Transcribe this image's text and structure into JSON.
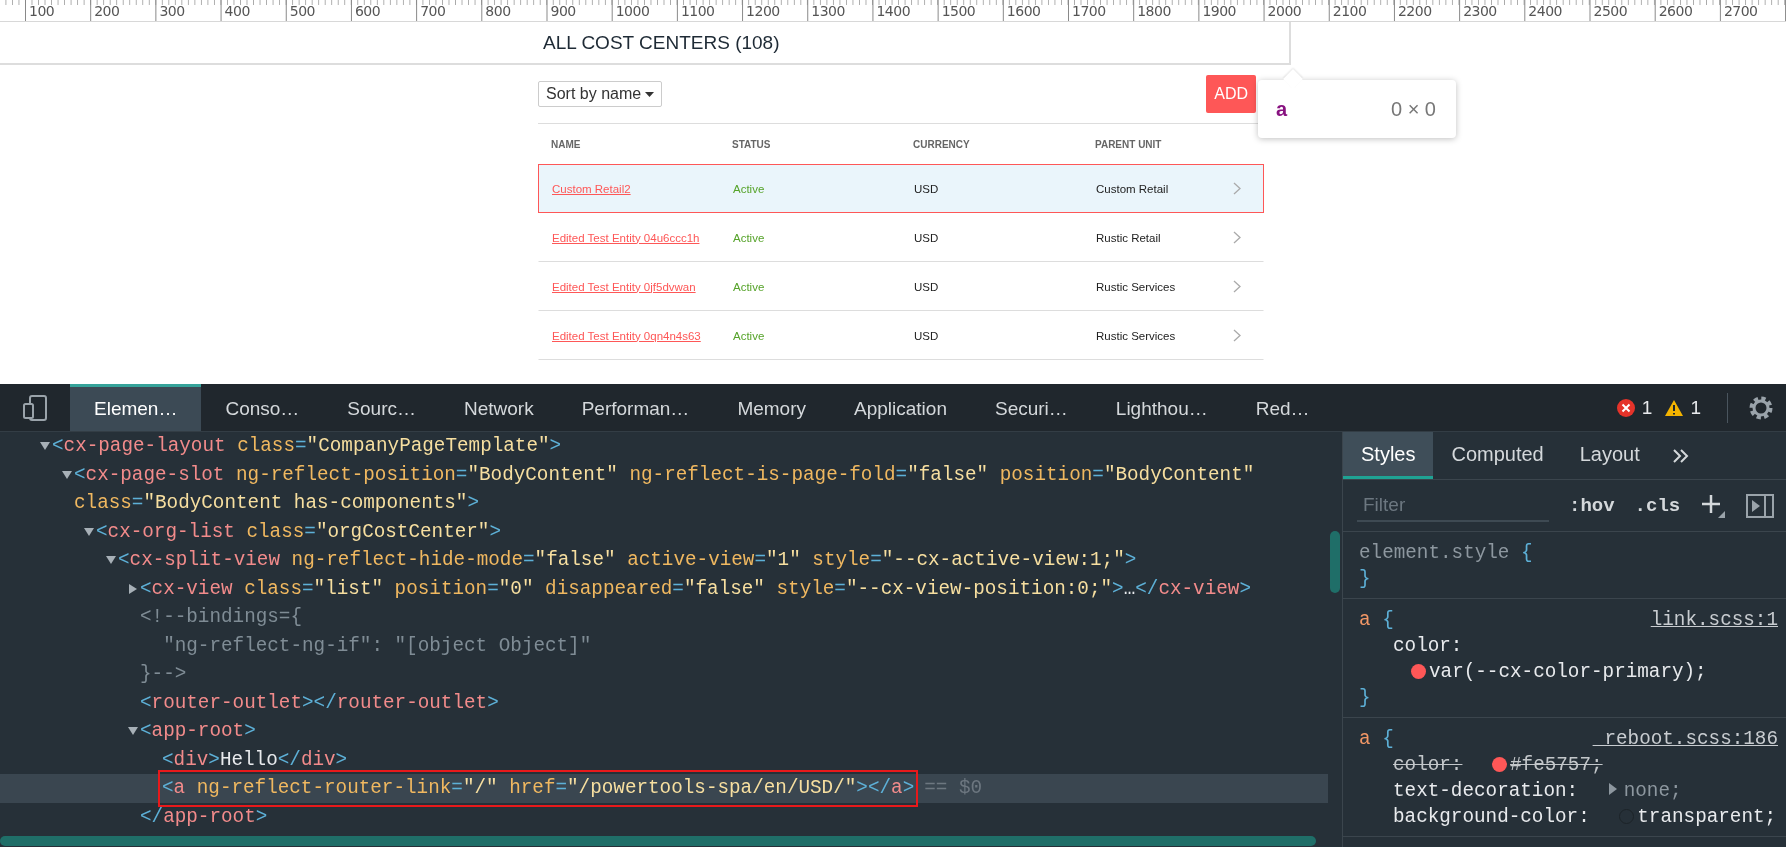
{
  "ruler": {
    "labels": [
      "100",
      "200",
      "300",
      "400",
      "500",
      "600",
      "700",
      "800",
      "900",
      "1000",
      "1100",
      "1200",
      "1300",
      "1400",
      "1500",
      "1600",
      "1700",
      "1800",
      "1900",
      "2000",
      "2100",
      "2200",
      "2300",
      "2400",
      "2500",
      "2600",
      "2700"
    ]
  },
  "page": {
    "title": "ALL COST CENTERS (108)",
    "sort": {
      "label": "Sort by name"
    },
    "add_button": "ADD",
    "table": {
      "columns": [
        "NAME",
        "STATUS",
        "CURRENCY",
        "PARENT UNIT"
      ],
      "rows": [
        {
          "name": "Custom Retail2",
          "status": "Active",
          "currency": "USD",
          "parent_unit": "Custom Retail",
          "selected": true
        },
        {
          "name": "Edited Test Entity 04u6ccc1h",
          "status": "Active",
          "currency": "USD",
          "parent_unit": "Rustic Retail",
          "selected": false
        },
        {
          "name": "Edited Test Entity 0jf5dvwan",
          "status": "Active",
          "currency": "USD",
          "parent_unit": "Rustic Services",
          "selected": false
        },
        {
          "name": "Edited Test Entity 0qn4n4s63",
          "status": "Active",
          "currency": "USD",
          "parent_unit": "Rustic Services",
          "selected": false
        }
      ]
    }
  },
  "inspect_tooltip": {
    "tag": "a",
    "size": "0 × 0"
  },
  "devtools": {
    "tabs": [
      {
        "label": "Elemen…",
        "selected": true
      },
      {
        "label": "Conso…",
        "selected": false
      },
      {
        "label": "Sourc…",
        "selected": false
      },
      {
        "label": "Network",
        "selected": false
      },
      {
        "label": "Performan…",
        "selected": false
      },
      {
        "label": "Memory",
        "selected": false
      },
      {
        "label": "Application",
        "selected": false
      },
      {
        "label": "Securi…",
        "selected": false
      },
      {
        "label": "Lighthou…",
        "selected": false
      },
      {
        "label": "Red…",
        "selected": false
      }
    ],
    "errors": "1",
    "warnings": "1",
    "dom_tree": [
      {
        "kind": "parent",
        "text": "<cx-page-layout class=\"CompanyPageTemplate\">",
        "expanded": true,
        "selected": false,
        "children": [
          {
            "kind": "parent",
            "text": "<cx-page-slot ng-reflect-position=\"BodyContent\" ng-reflect-is-page-fold=\"false\" position=\"BodyContent\" class=\"BodyContent has-components\">",
            "expanded": true,
            "selected": false,
            "children": [
              {
                "kind": "parent",
                "text": "<cx-org-list class=\"orgCostCenter\">",
                "expanded": true,
                "selected": false,
                "children": [
                  {
                    "kind": "parent",
                    "text": "<cx-split-view ng-reflect-hide-mode=\"false\" active-view=\"1\" style=\"--cx-active-view:1;\">",
                    "expanded": true,
                    "selected": false,
                    "children": [
                      {
                        "kind": "parent",
                        "text": "<cx-view class=\"list\" position=\"0\" disappeared=\"false\" style=\"--cx-view-position:0;\">…</cx-view>",
                        "expanded": false,
                        "selected": false
                      },
                      {
                        "kind": "comment",
                        "text": "<!--bindings={\n  \"ng-reflect-ng-if\": \"[object Object]\"\n}-->",
                        "selected": false
                      },
                      {
                        "kind": "leaf",
                        "text": "<router-outlet></router-outlet>",
                        "selected": false
                      },
                      {
                        "kind": "parent",
                        "text": "<app-root>",
                        "expanded": true,
                        "selected": false,
                        "close": "</app-root>",
                        "children": [
                          {
                            "kind": "leaf",
                            "text": "<div>Hello</div>",
                            "selected": false
                          },
                          {
                            "kind": "leaf",
                            "text": "<a ng-reflect-router-link=\"/\" href=\"/powertools-spa/en/USD/\"></a>",
                            "selected": true,
                            "hint": "== $0"
                          }
                        ]
                      }
                    ]
                  }
                ]
              }
            ]
          }
        ]
      }
    ],
    "styles_panel": {
      "tabs": [
        {
          "label": "Styles",
          "selected": true
        },
        {
          "label": "Computed",
          "selected": false
        },
        {
          "label": "Layout",
          "selected": false
        }
      ],
      "filter": {
        "placeholder": "Filter"
      },
      "hov": ":hov",
      "cls": ".cls",
      "rules": [
        {
          "kind": "inline",
          "selector": "element.style",
          "open_brace": "{",
          "close_brace": "}"
        },
        {
          "kind": "rule",
          "selector": "a",
          "open_brace": "{",
          "close_brace": "}",
          "source": "link.scss:1",
          "declarations": [
            {
              "kind": "color",
              "property": "color:",
              "value": "var(--cx-color-primary);",
              "color": "#fe5757",
              "struck": false,
              "dimmed": false
            }
          ]
        },
        {
          "kind": "rule",
          "selector": "a",
          "open_brace": "{",
          "source": "_reboot.scss:186",
          "declarations": [
            {
              "kind": "color",
              "property": "color:",
              "value": "#fe5757;",
              "color": "#fe5757",
              "struck": true,
              "dimmed": false
            },
            {
              "kind": "expandable",
              "property": "text-decoration:",
              "value": "none;",
              "struck": false,
              "dimmed": true
            },
            {
              "kind": "transparent",
              "property": "background-color:",
              "value": "transparent;",
              "struck": false,
              "dimmed": false
            }
          ]
        }
      ]
    }
  }
}
